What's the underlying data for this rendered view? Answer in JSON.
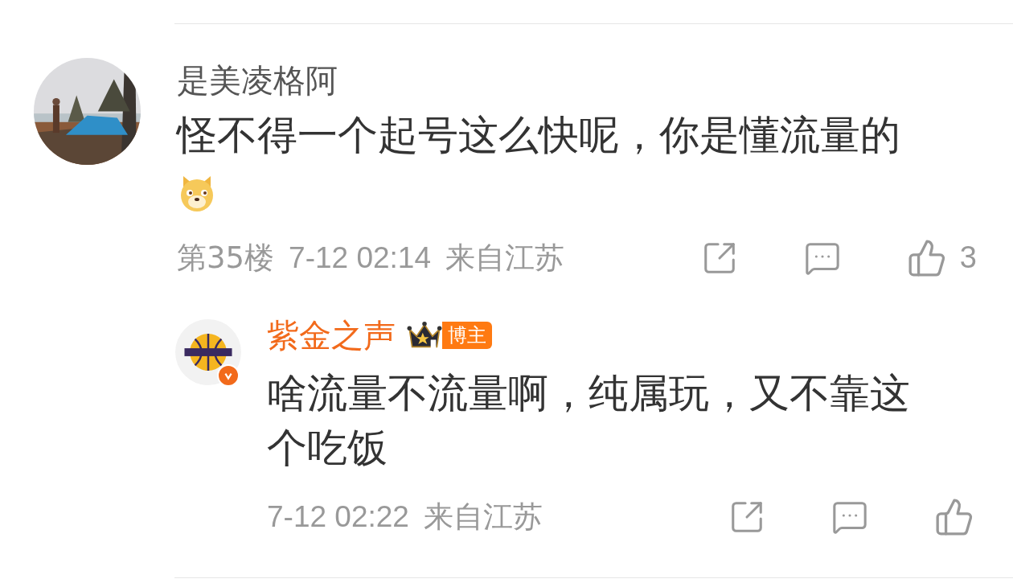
{
  "comment": {
    "author": "是美凌格阿",
    "text": "怪不得一个起号这么快呢，你是懂流量的",
    "has_emoji": true,
    "floor": "第35楼",
    "time": "7-12 02:14",
    "location": "来自江苏",
    "likes": "3"
  },
  "reply": {
    "author": "紫金之声",
    "is_host": true,
    "verified": true,
    "host_tag": "博主",
    "text": "啥流量不流量啊，纯属玩，又不靠这个吃饭",
    "time": "7-12 02:22",
    "location": "来自江苏"
  }
}
